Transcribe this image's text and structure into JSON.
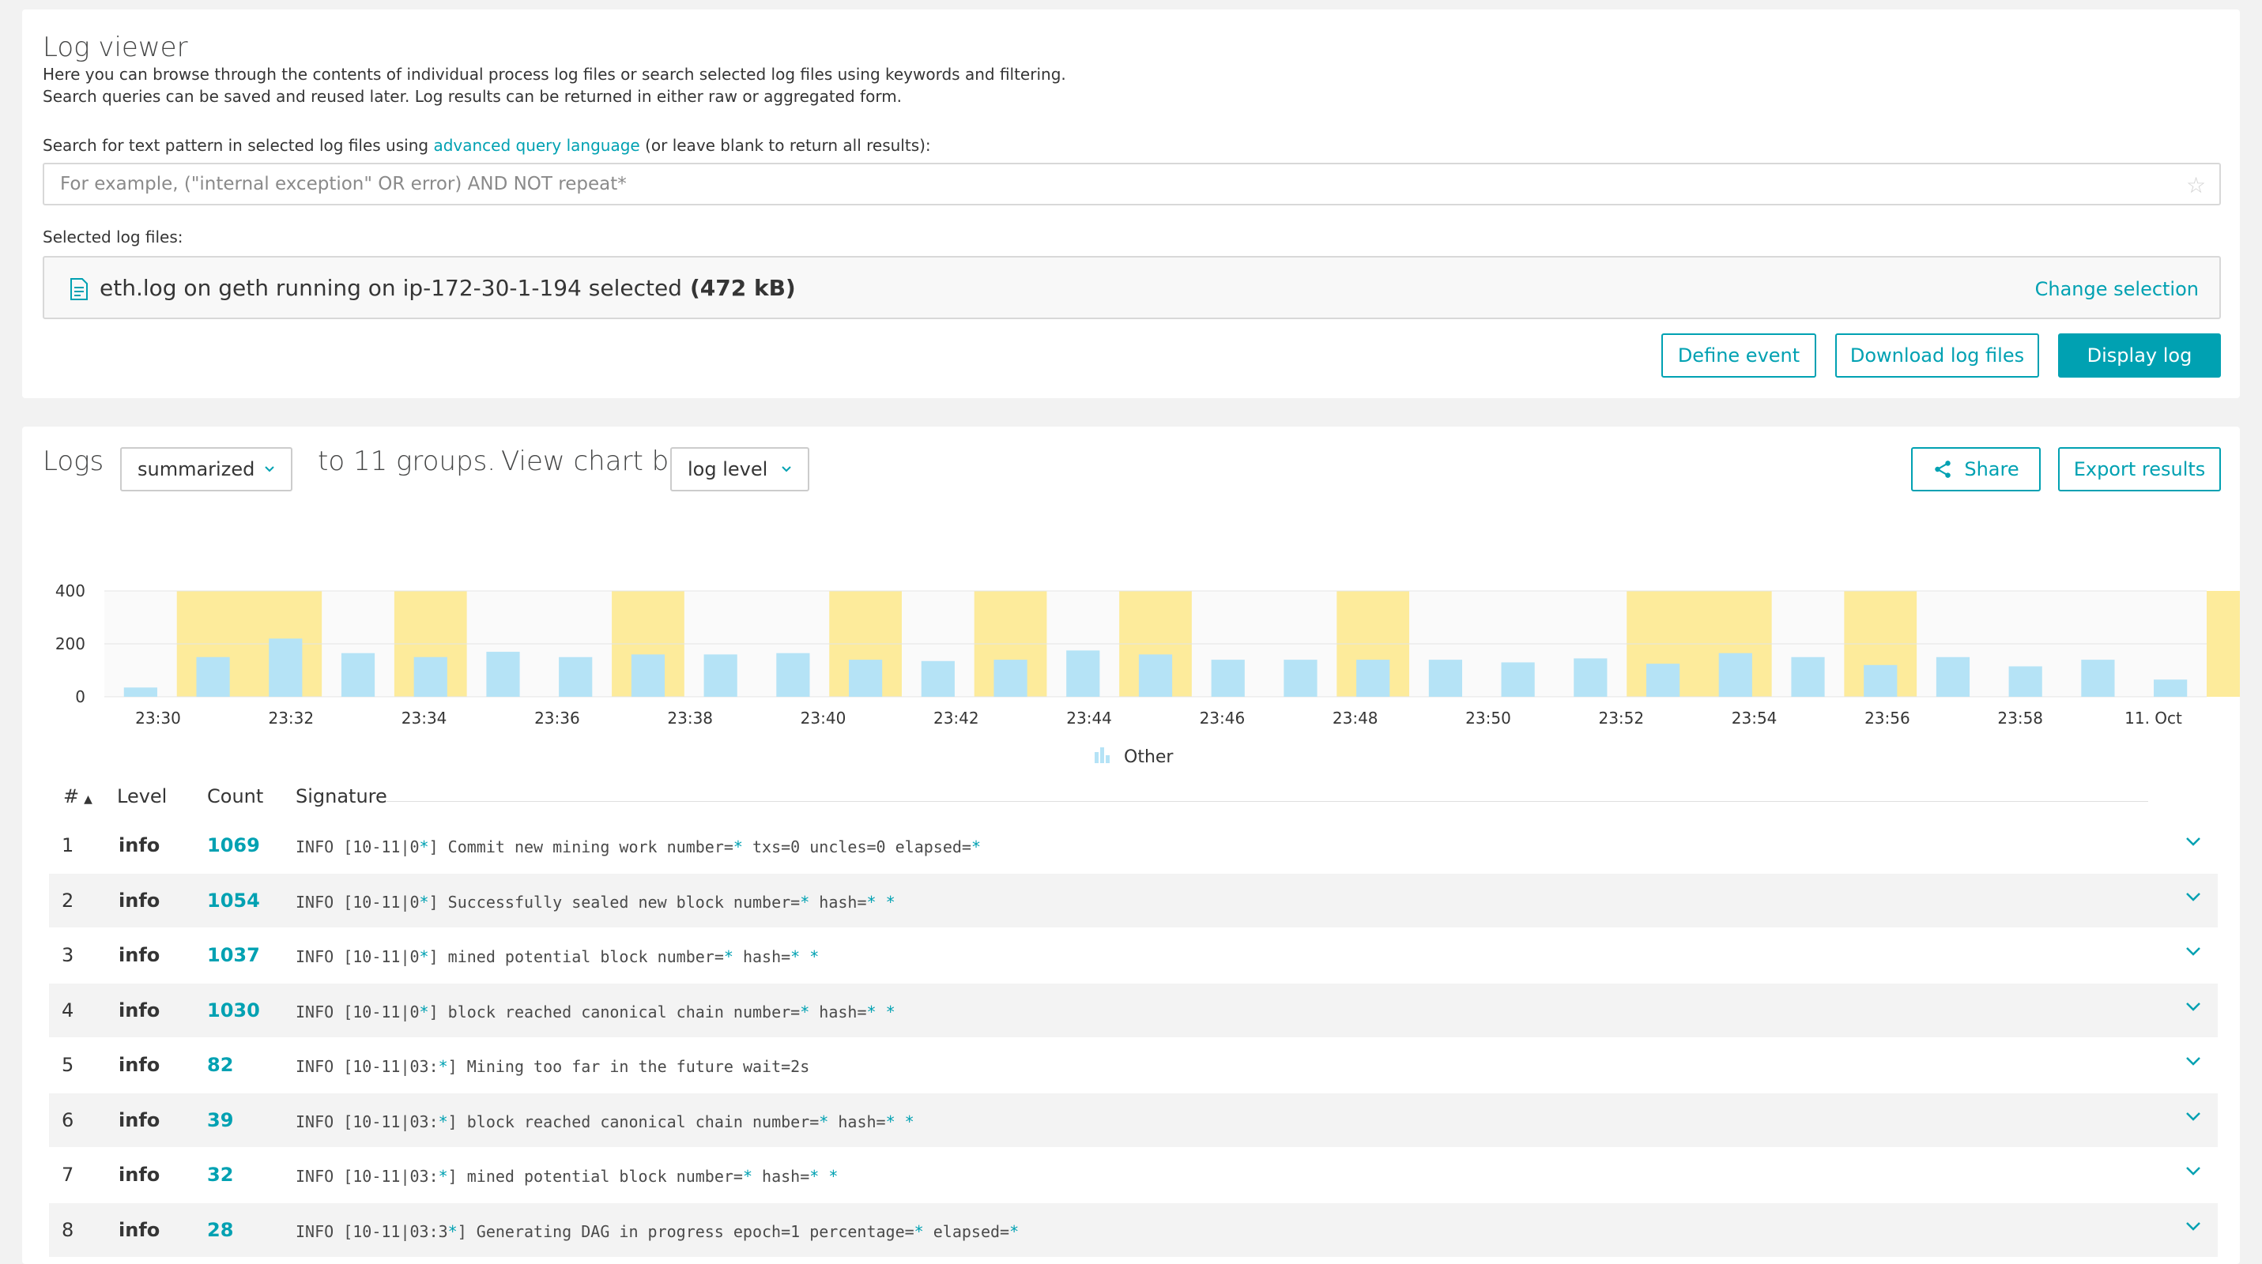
{
  "header": {
    "title": "Log viewer",
    "desc1": "Here you can browse through the contents of individual process log files or search selected log files using keywords and filtering.",
    "desc2": "Search queries can be saved and reused later. Log results can be returned in either raw or aggregated form.",
    "search_label_pre": "Search for text pattern in selected log files using ",
    "search_label_link": "advanced query language",
    "search_label_post": " (or leave blank to return all results):",
    "search_placeholder": "For example, (\"internal exception\" OR error) AND NOT repeat*",
    "selected_label": "Selected log files:",
    "selected_text": "eth.log on geth running on ip-172-30-1-194 selected",
    "selected_size": "(472 kB)",
    "change_selection": "Change selection",
    "buttons": {
      "define_event": "Define event",
      "download": "Download log files",
      "display": "Display log"
    }
  },
  "logs": {
    "title": "Logs",
    "mode": "summarized",
    "groups_text": "to 11 groups.",
    "view_chart_by": "View chart by",
    "chart_by_value": "log level",
    "share": "Share",
    "export": "Export results"
  },
  "chart_data": {
    "type": "bar",
    "ylim": [
      0,
      400
    ],
    "yticks": [
      0,
      200,
      400
    ],
    "xtick_labels": [
      "23:30",
      "23:32",
      "23:34",
      "23:36",
      "23:38",
      "23:40",
      "23:42",
      "23:44",
      "23:46",
      "23:48",
      "23:50",
      "23:52",
      "23:54",
      "23:56",
      "23:58",
      "11. Oct"
    ],
    "series": [
      {
        "name": "Other",
        "color": "#b5e3f6",
        "values": [
          35,
          150,
          220,
          165,
          150,
          170,
          150,
          160,
          160,
          165,
          140,
          135,
          140,
          175,
          160,
          140,
          140,
          140,
          140,
          130,
          145,
          125,
          165,
          150,
          120,
          150,
          115,
          140,
          65
        ]
      }
    ],
    "highlight_color": "#fdeb9b",
    "highlight_spans": [
      [
        1,
        2
      ],
      [
        4,
        4
      ],
      [
        7,
        7
      ],
      [
        10,
        10
      ],
      [
        12,
        12
      ],
      [
        14,
        14
      ],
      [
        17,
        17
      ],
      [
        21,
        22
      ],
      [
        24,
        24
      ],
      [
        29,
        29
      ]
    ],
    "legend": "Other"
  },
  "table": {
    "headers": {
      "num": "#",
      "level": "Level",
      "count": "Count",
      "signature": "Signature"
    },
    "rows": [
      {
        "num": "1",
        "level": "info",
        "count": "1069",
        "sig": "INFO [10-11|0*] Commit new mining work number=* txs=0 uncles=0 elapsed=*"
      },
      {
        "num": "2",
        "level": "info",
        "count": "1054",
        "sig": "INFO [10-11|0*] Successfully sealed new block number=* hash=* *"
      },
      {
        "num": "3",
        "level": "info",
        "count": "1037",
        "sig": "INFO [10-11|0*] mined potential block number=* hash=* *"
      },
      {
        "num": "4",
        "level": "info",
        "count": "1030",
        "sig": "INFO [10-11|0*] block reached canonical chain number=* hash=* *"
      },
      {
        "num": "5",
        "level": "info",
        "count": "82",
        "sig": "INFO [10-11|03:*] Mining too far in the future wait=2s"
      },
      {
        "num": "6",
        "level": "info",
        "count": "39",
        "sig": "INFO [10-11|03:*] block reached canonical chain number=* hash=* *"
      },
      {
        "num": "7",
        "level": "info",
        "count": "32",
        "sig": "INFO [10-11|03:*] mined potential block number=* hash=* *"
      },
      {
        "num": "8",
        "level": "info",
        "count": "28",
        "sig": "INFO [10-11|03:3*] Generating DAG in progress epoch=1 percentage=* elapsed=*"
      }
    ]
  }
}
